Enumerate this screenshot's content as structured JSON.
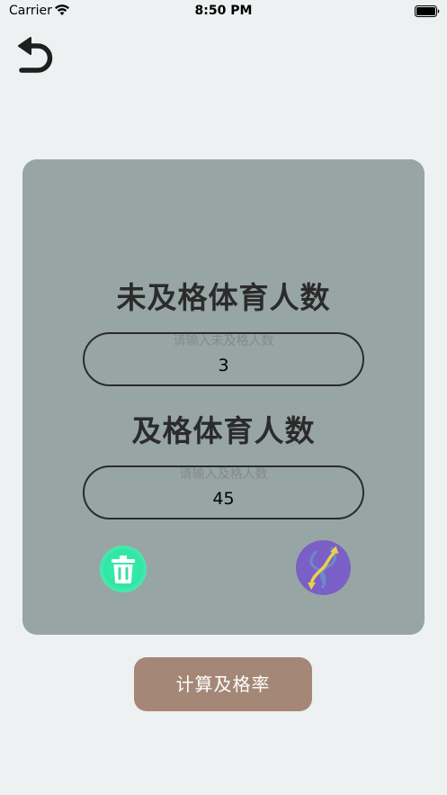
{
  "status_bar": {
    "carrier": "Carrier",
    "time": "8:50 PM"
  },
  "form": {
    "failed_title": "未及格体育人数",
    "failed_placeholder": "请输入未及格人数",
    "failed_value": "3",
    "passed_title": "及格体育人数",
    "passed_placeholder": "请输入及格人数",
    "passed_value": "45"
  },
  "actions": {
    "calculate_label": "计算及格率"
  },
  "icons": {
    "back": "back-arrow-icon",
    "clear": "trash-icon",
    "swap": "swap-arrows-icon"
  },
  "colors": {
    "background": "#eef1f2",
    "card": "#97a6a4",
    "clear_button": "#2fe6a5",
    "swap_button": "#7a5fc7",
    "calculate_button": "#a48776"
  }
}
